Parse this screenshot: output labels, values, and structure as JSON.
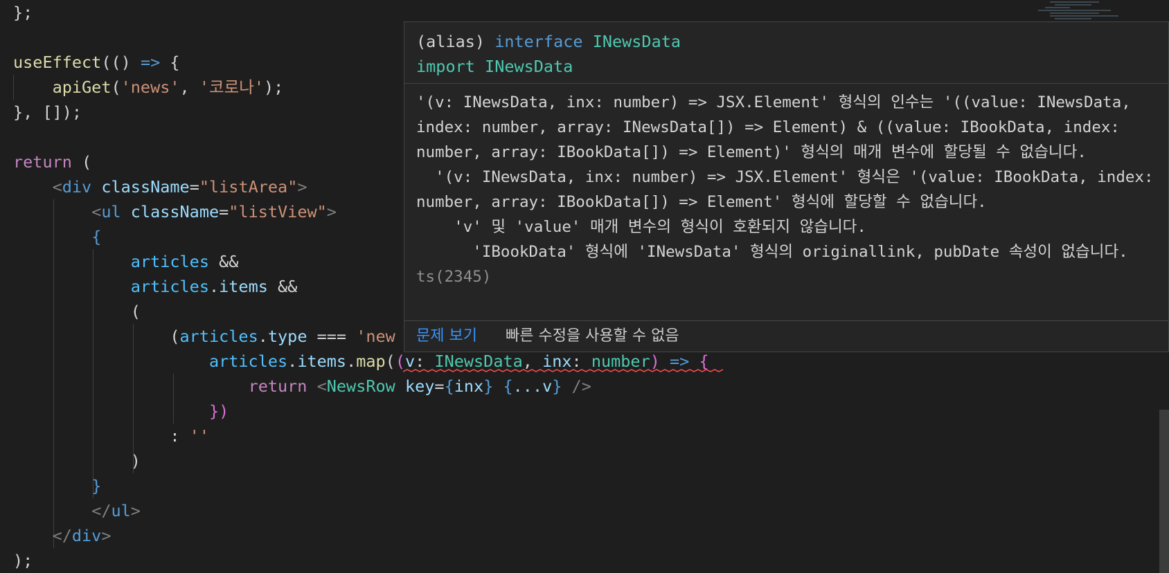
{
  "code_lines": [
    [
      [
        "};",
        "#d4d4d4"
      ]
    ],
    [],
    [
      [
        "useEffect",
        "#dcdcaa"
      ],
      [
        "(() ",
        "#d4d4d4"
      ],
      [
        "=>",
        "#569cd6"
      ],
      [
        " {",
        "#d4d4d4"
      ]
    ],
    [
      [
        "    ",
        "#d4d4d4"
      ],
      [
        "apiGet",
        "#dcdcaa"
      ],
      [
        "(",
        "#d4d4d4"
      ],
      [
        "'news'",
        "#ce9178"
      ],
      [
        ", ",
        "#d4d4d4"
      ],
      [
        "'코로나'",
        "#ce9178"
      ],
      [
        ");",
        "#d4d4d4"
      ]
    ],
    [
      [
        "}, []);",
        "#d4d4d4"
      ]
    ],
    [],
    [
      [
        "return",
        "#c586c0"
      ],
      [
        " (",
        "#d4d4d4"
      ]
    ],
    [
      [
        "    ",
        "#d4d4d4"
      ],
      [
        "<",
        "#808080"
      ],
      [
        "div",
        "#569cd6"
      ],
      [
        " ",
        "#d4d4d4"
      ],
      [
        "className",
        "#9cdcfe"
      ],
      [
        "=",
        "#d4d4d4"
      ],
      [
        "\"listArea\"",
        "#ce9178"
      ],
      [
        ">",
        "#808080"
      ]
    ],
    [
      [
        "        ",
        "#d4d4d4"
      ],
      [
        "<",
        "#808080"
      ],
      [
        "ul",
        "#569cd6"
      ],
      [
        " ",
        "#d4d4d4"
      ],
      [
        "className",
        "#9cdcfe"
      ],
      [
        "=",
        "#d4d4d4"
      ],
      [
        "\"listView\"",
        "#ce9178"
      ],
      [
        ">",
        "#808080"
      ]
    ],
    [
      [
        "        ",
        "#d4d4d4"
      ],
      [
        "{",
        "#569cd6"
      ]
    ],
    [
      [
        "            ",
        "#d4d4d4"
      ],
      [
        "articles",
        "#4fc1ff"
      ],
      [
        " &&",
        "#d4d4d4"
      ]
    ],
    [
      [
        "            ",
        "#d4d4d4"
      ],
      [
        "articles",
        "#4fc1ff"
      ],
      [
        ".",
        "#d4d4d4"
      ],
      [
        "items",
        "#9cdcfe"
      ],
      [
        " &&",
        "#d4d4d4"
      ]
    ],
    [
      [
        "            ",
        "#d4d4d4"
      ],
      [
        "(",
        "#d4d4d4"
      ]
    ],
    [
      [
        "                ",
        "#d4d4d4"
      ],
      [
        "(",
        "#d4d4d4"
      ],
      [
        "articles",
        "#4fc1ff"
      ],
      [
        ".",
        "#d4d4d4"
      ],
      [
        "type",
        "#9cdcfe"
      ],
      [
        " === ",
        "#d4d4d4"
      ],
      [
        "'new",
        "#ce9178"
      ]
    ],
    [
      [
        "                    ",
        "#d4d4d4"
      ],
      [
        "articles",
        "#4fc1ff"
      ],
      [
        ".",
        "#d4d4d4"
      ],
      [
        "items",
        "#9cdcfe"
      ],
      [
        ".",
        "#d4d4d4"
      ],
      [
        "map",
        "#dcdcaa"
      ],
      [
        "(",
        "#d4d4d4"
      ],
      [
        "(",
        "#da70d6"
      ],
      [
        "v",
        "#9cdcfe"
      ],
      [
        ": ",
        "#d4d4d4"
      ],
      [
        "INewsData",
        "#4ec9b0"
      ],
      [
        ", ",
        "#d4d4d4"
      ],
      [
        "inx",
        "#9cdcfe"
      ],
      [
        ": ",
        "#d4d4d4"
      ],
      [
        "number",
        "#4ec9b0"
      ],
      [
        ") ",
        "#da70d6"
      ],
      [
        "=>",
        "#569cd6"
      ],
      [
        " {",
        "#da70d6"
      ]
    ],
    [
      [
        "                        ",
        "#d4d4d4"
      ],
      [
        "return",
        "#c586c0"
      ],
      [
        " ",
        "#d4d4d4"
      ],
      [
        "<",
        "#808080"
      ],
      [
        "NewsRow",
        "#4ec9b0"
      ],
      [
        " ",
        "#d4d4d4"
      ],
      [
        "key",
        "#9cdcfe"
      ],
      [
        "=",
        "#d4d4d4"
      ],
      [
        "{",
        "#569cd6"
      ],
      [
        "inx",
        "#9cdcfe"
      ],
      [
        "}",
        "#569cd6"
      ],
      [
        " ",
        "#d4d4d4"
      ],
      [
        "{",
        "#569cd6"
      ],
      [
        "...v",
        "#9cdcfe"
      ],
      [
        "}",
        "#569cd6"
      ],
      [
        " ",
        "#d4d4d4"
      ],
      [
        "/>",
        "#808080"
      ]
    ],
    [
      [
        "                    ",
        "#d4d4d4"
      ],
      [
        "})",
        "#da70d6"
      ]
    ],
    [
      [
        "                ",
        "#d4d4d4"
      ],
      [
        ": ",
        "#d4d4d4"
      ],
      [
        "''",
        "#ce9178"
      ]
    ],
    [
      [
        "            ",
        "#d4d4d4"
      ],
      [
        ")",
        "#d4d4d4"
      ]
    ],
    [
      [
        "        ",
        "#d4d4d4"
      ],
      [
        "}",
        "#569cd6"
      ]
    ],
    [
      [
        "        ",
        "#d4d4d4"
      ],
      [
        "</",
        "#808080"
      ],
      [
        "ul",
        "#569cd6"
      ],
      [
        ">",
        "#808080"
      ]
    ],
    [
      [
        "    ",
        "#d4d4d4"
      ],
      [
        "</",
        "#808080"
      ],
      [
        "div",
        "#569cd6"
      ],
      [
        ">",
        "#808080"
      ]
    ],
    [
      [
        ");",
        "#d4d4d4"
      ]
    ]
  ],
  "hover": {
    "alias_prefix": "(alias) ",
    "alias_keyword": "interface",
    "alias_name": "INewsData",
    "import_keyword": "import",
    "import_name": "INewsData",
    "message": "'(v: INewsData, inx: number) => JSX.Element' 형식의 인수는 '((value: INewsData, index: number, array: INewsData[]) => Element) & ((value: IBookData, index: number, array: IBookData[]) => Element)' 형식의 매개 변수에 할당될 수 없습니다.\n  '(v: INewsData, inx: number) => JSX.Element' 형식은 '(value: IBookData, index: number, array: IBookData[]) => Element' 형식에 할당할 수 없습니다.\n    'v' 및 'value' 매개 변수의 형식이 호환되지 않습니다.\n      'IBookData' 형식에 'INewsData' 형식의 originallink, pubDate 속성이 없습니다.",
    "error_code": "ts(2345)",
    "view_problem": "문제 보기",
    "no_quick_fix": "빠른 수정을 사용할 수 없음"
  },
  "colors": {
    "background": "#1e1e1e",
    "hover_background": "#252526",
    "link": "#3794ff",
    "error": "#f14c4c"
  }
}
